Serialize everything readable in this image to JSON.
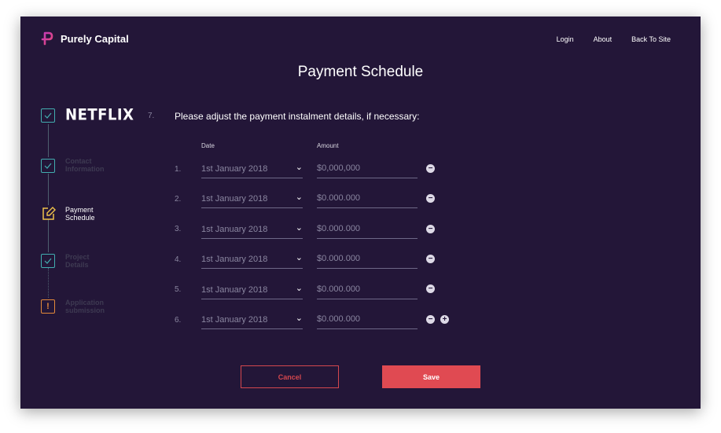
{
  "brand": {
    "name": "Purely Capital"
  },
  "nav": [
    "Login",
    "About",
    "Back To Site"
  ],
  "page_title": "Payment Schedule",
  "steps": {
    "company": "NETFLIX",
    "contact": "Contact Information",
    "payment": "Payment Schedule",
    "project": "Project Details",
    "application": "Application submission"
  },
  "question": {
    "number": "7.",
    "text": "Please adjust the payment instalment details, if necessary:"
  },
  "columns": {
    "date": "Date",
    "amount": "Amount"
  },
  "rows": [
    {
      "num": "1.",
      "date": "1st January 2018",
      "amount": "$0,000,000"
    },
    {
      "num": "2.",
      "date": "1st January 2018",
      "amount": "$0.000.000"
    },
    {
      "num": "3.",
      "date": "1st January 2018",
      "amount": "$0.000.000"
    },
    {
      "num": "4.",
      "date": "1st January 2018",
      "amount": "$0.000.000"
    },
    {
      "num": "5.",
      "date": "1st January 2018",
      "amount": "$0.000.000"
    },
    {
      "num": "6.",
      "date": "1st January 2018",
      "amount": "$0.000.000"
    }
  ],
  "buttons": {
    "cancel": "Cancel",
    "save": "Save"
  },
  "colors": {
    "background": "#231638",
    "accent_teal": "#42aeb0",
    "accent_red": "#e04a52",
    "warning": "#e3893a",
    "active_step": "#f0c24a"
  },
  "icons": [
    "logo-mark",
    "check-icon",
    "edit-icon",
    "exclamation-icon",
    "chevron-down-icon",
    "minus-icon",
    "plus-icon"
  ]
}
